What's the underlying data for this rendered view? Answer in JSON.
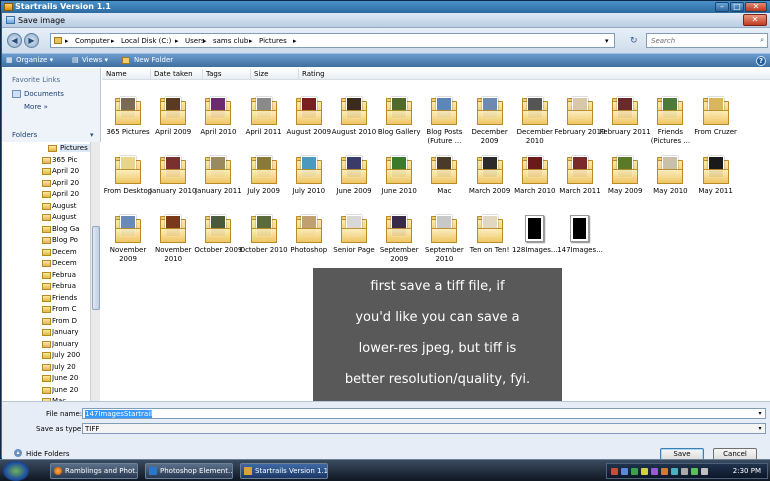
{
  "window": {
    "title": "Startrails Version 1.1"
  },
  "dialog": {
    "title": "Save image",
    "close_glyph": "✕"
  },
  "address": {
    "crumbs": [
      "Computer",
      "Local Disk (C:)",
      "Users",
      "sams club",
      "Pictures"
    ],
    "search_placeholder": "Search"
  },
  "toolbar": {
    "organize": "Organize",
    "views": "Views",
    "new_folder": "New Folder"
  },
  "left": {
    "favorite_links": "Favorite Links",
    "documents": "Documents",
    "more": "More",
    "folders": "Folders",
    "tree": [
      "Pictures",
      "365 Pic",
      "April 20",
      "April 20",
      "April 20",
      "August",
      "August",
      "Blog Ga",
      "Blog Po",
      "Decem",
      "Decem",
      "Februa",
      "Februa",
      "Friends",
      "From C",
      "From D",
      "January",
      "January",
      "July 200",
      "July 20",
      "June 20",
      "June 20",
      "Mac"
    ]
  },
  "columns": [
    "Name",
    "Date taken",
    "Tags",
    "Size",
    "Rating"
  ],
  "files": [
    {
      "label": "365 Pictures",
      "photo": "#7a6a55",
      "kind": "folder"
    },
    {
      "label": "April 2009",
      "photo": "#5a3a22",
      "kind": "folder"
    },
    {
      "label": "April 2010",
      "photo": "#6b2b6e",
      "kind": "folder"
    },
    {
      "label": "April 2011",
      "photo": "#8a8a8a",
      "kind": "folder"
    },
    {
      "label": "August 2009",
      "photo": "#7a1f1f",
      "kind": "folder"
    },
    {
      "label": "August 2010",
      "photo": "#3a2a20",
      "kind": "folder"
    },
    {
      "label": "Blog Gallery",
      "photo": "#4f6a2a",
      "kind": "folder"
    },
    {
      "label": "Blog Posts (Future ...",
      "photo": "#5d86b8",
      "kind": "folder"
    },
    {
      "label": "December 2009",
      "photo": "#6d8bb0",
      "kind": "folder"
    },
    {
      "label": "December 2010",
      "photo": "#555555",
      "kind": "folder"
    },
    {
      "label": "February 2010",
      "photo": "#d8c7a8",
      "kind": "folder"
    },
    {
      "label": "February 2011",
      "photo": "#6a2a2a",
      "kind": "folder"
    },
    {
      "label": "Friends (Pictures ...",
      "photo": "#4c7a3a",
      "kind": "folder"
    },
    {
      "label": "From Cruzer",
      "photo": "#d9b65b",
      "kind": "folder"
    },
    {
      "label": "From Desktop",
      "photo": "#e8d48a",
      "kind": "folder"
    },
    {
      "label": "January 2010",
      "photo": "#7b3030",
      "kind": "folder"
    },
    {
      "label": "January 2011",
      "photo": "#9a8a60",
      "kind": "folder"
    },
    {
      "label": "July 2009",
      "photo": "#8a7a3a",
      "kind": "folder"
    },
    {
      "label": "July 2010",
      "photo": "#4a9ac0",
      "kind": "folder"
    },
    {
      "label": "June 2009",
      "photo": "#3b3b6a",
      "kind": "folder"
    },
    {
      "label": "June 2010",
      "photo": "#3a7a2a",
      "kind": "folder"
    },
    {
      "label": "Mac",
      "photo": "#4a3a2a",
      "kind": "folder"
    },
    {
      "label": "March 2009",
      "photo": "#2a2a2a",
      "kind": "folder"
    },
    {
      "label": "March 2010",
      "photo": "#6a1a1a",
      "kind": "folder"
    },
    {
      "label": "March 2011",
      "photo": "#7a2a2a",
      "kind": "folder"
    },
    {
      "label": "May 2009",
      "photo": "#5a7a2a",
      "kind": "folder"
    },
    {
      "label": "May 2010",
      "photo": "#c8c0a8",
      "kind": "folder"
    },
    {
      "label": "May 2011",
      "photo": "#1a1a1a",
      "kind": "folder"
    },
    {
      "label": "November 2009",
      "photo": "#6a8ab8",
      "kind": "folder"
    },
    {
      "label": "November 2010",
      "photo": "#7a3a1a",
      "kind": "folder"
    },
    {
      "label": "October 2009",
      "photo": "#4a5a3a",
      "kind": "folder"
    },
    {
      "label": "October 2010",
      "photo": "#5a6a3a",
      "kind": "folder"
    },
    {
      "label": "Photoshop",
      "photo": "#c0a070",
      "kind": "folder"
    },
    {
      "label": "Senior Page",
      "photo": "#d8d8d8",
      "kind": "folder"
    },
    {
      "label": "September 2009",
      "photo": "#3a2a4a",
      "kind": "folder"
    },
    {
      "label": "September 2010",
      "photo": "#c8c8c8",
      "kind": "folder"
    },
    {
      "label": "Ten on Ten!",
      "photo": "#e0d8c0",
      "kind": "folder"
    },
    {
      "label": "128Images...",
      "photo": "#000000",
      "kind": "image"
    },
    {
      "label": "147Images...",
      "photo": "#000000",
      "kind": "image"
    }
  ],
  "note": {
    "lines": [
      "first save a tiff file, if",
      "you'd like you can save a",
      "lower-res jpeg, but tiff is",
      "better resolution/quality, fyi."
    ]
  },
  "bottom": {
    "file_name_label": "File name:",
    "file_name_value": "147ImagesStartrail",
    "save_type_label": "Save as type:",
    "save_type_value": "TIFF",
    "hide_folders": "Hide Folders",
    "save": "Save",
    "cancel": "Cancel"
  },
  "taskbar": {
    "items": [
      "Ramblings and Phot...",
      "Photoshop Element...",
      "Startrails Version 1.1"
    ],
    "clock": "2:30 PM"
  }
}
